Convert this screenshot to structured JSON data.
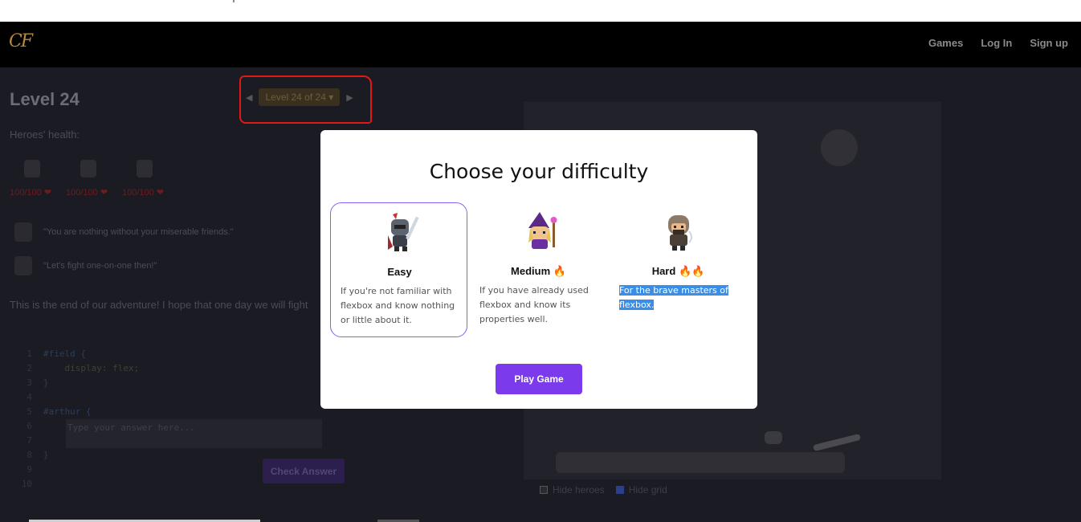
{
  "navbar": {
    "logo": "CF",
    "links": [
      "Games",
      "Log In",
      "Sign up"
    ]
  },
  "level": {
    "title": "Level 24",
    "selector": "Level 24 of 24 ▾"
  },
  "heroes": {
    "label": "Heroes' health:",
    "hp": [
      "100/100 ❤",
      "100/100 ❤",
      "100/100 ❤"
    ]
  },
  "dialogue": {
    "quote1": "\"You are nothing without your miserable friends.\"",
    "quote2": "\"Let's fight one-on-one then!\""
  },
  "story": "This is the end of our adventure! I hope that one day we will fight",
  "code": {
    "lines": [
      {
        "n": "1",
        "text": "#field {"
      },
      {
        "n": "2",
        "text": "    display: flex;"
      },
      {
        "n": "3",
        "text": "}"
      },
      {
        "n": "4",
        "text": ""
      },
      {
        "n": "5",
        "text": "#arthur {"
      },
      {
        "n": "6",
        "text": ""
      },
      {
        "n": "7",
        "text": ""
      },
      {
        "n": "8",
        "text": "}"
      },
      {
        "n": "9",
        "text": ""
      },
      {
        "n": "10",
        "text": ""
      }
    ],
    "answer_placeholder": "Type your answer here...",
    "check_label": "Check Answer"
  },
  "board": {
    "hide_heroes": "Hide heroes",
    "hide_grid": "Hide grid"
  },
  "modal": {
    "title": "Choose your difficulty",
    "options": [
      {
        "name": "Easy",
        "fire": "",
        "desc": "If you're not familiar with flexbox and know nothing or little about it."
      },
      {
        "name": "Medium",
        "fire": "🔥",
        "desc": "If you have already used flexbox and know its properties well."
      },
      {
        "name": "Hard",
        "fire": "🔥🔥",
        "desc": "For the brave masters of flexbox."
      }
    ],
    "play_label": "Play Game"
  },
  "colors": {
    "accent": "#7c3aed",
    "selection": "#3a8ee6",
    "annotation": "#e11818"
  }
}
